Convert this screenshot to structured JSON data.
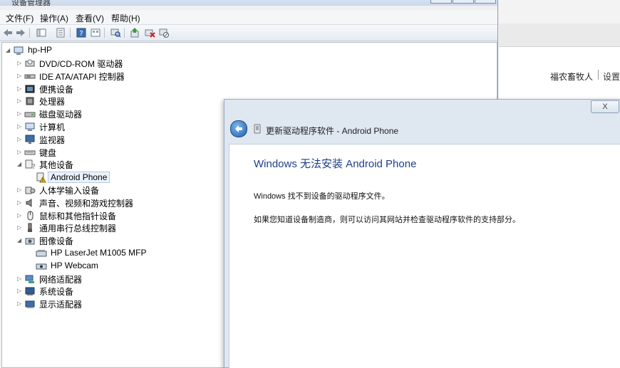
{
  "background_app": {
    "user_name": "福农畜牧人",
    "settings_label": "设置"
  },
  "device_manager": {
    "title": "设备管理器",
    "menu": [
      "文件(F)",
      "操作(A)",
      "查看(V)",
      "帮助(H)"
    ],
    "toolbar_icons": [
      "back-arrow-icon",
      "forward-arrow-icon",
      "console-tree-icon",
      "properties-icon",
      "help-icon",
      "view-icon",
      "scan-hardware-icon",
      "update-driver-icon",
      "uninstall-icon",
      "disable-icon"
    ],
    "tree": {
      "root": "hp-HP",
      "items": [
        {
          "label": "DVD/CD-ROM 驱动器",
          "icon": "dvd-drive-icon",
          "expanded": false
        },
        {
          "label": "IDE ATA/ATAPI 控制器",
          "icon": "ide-controller-icon",
          "expanded": false
        },
        {
          "label": "便携设备",
          "icon": "portable-device-icon",
          "expanded": false
        },
        {
          "label": "处理器",
          "icon": "processor-icon",
          "expanded": false
        },
        {
          "label": "磁盘驱动器",
          "icon": "disk-drive-icon",
          "expanded": false
        },
        {
          "label": "计算机",
          "icon": "computer-icon",
          "expanded": false
        },
        {
          "label": "监视器",
          "icon": "monitor-icon",
          "expanded": false
        },
        {
          "label": "键盘",
          "icon": "keyboard-icon",
          "expanded": false
        },
        {
          "label": "其他设备",
          "icon": "other-devices-icon",
          "expanded": true
        },
        {
          "label": "Android Phone",
          "icon": "unknown-device-warning-icon",
          "child": true,
          "selected": true
        },
        {
          "label": "人体学输入设备",
          "icon": "hid-icon",
          "expanded": false
        },
        {
          "label": "声音、视频和游戏控制器",
          "icon": "sound-icon",
          "expanded": false
        },
        {
          "label": "鼠标和其他指针设备",
          "icon": "mouse-icon",
          "expanded": false
        },
        {
          "label": "通用串行总线控制器",
          "icon": "usb-icon",
          "expanded": false
        },
        {
          "label": "图像设备",
          "icon": "imaging-device-icon",
          "expanded": true
        },
        {
          "label": "HP LaserJet M1005 MFP",
          "icon": "scanner-icon",
          "child": true
        },
        {
          "label": "HP Webcam",
          "icon": "webcam-icon",
          "child": true
        },
        {
          "label": "网络适配器",
          "icon": "network-adapter-icon",
          "expanded": false
        },
        {
          "label": "系统设备",
          "icon": "system-device-icon",
          "expanded": false
        },
        {
          "label": "显示适配器",
          "icon": "display-adapter-icon",
          "expanded": false
        }
      ]
    }
  },
  "dialog": {
    "close_label": "X",
    "header_title": "更新驱动程序软件 - Android Phone",
    "heading": "Windows 无法安装 Android Phone",
    "message1": "Windows 找不到设备的驱动程序文件。",
    "message2": "如果您知道设备制造商，则可以访问其网站并检查驱动程序软件的支持部分。"
  }
}
